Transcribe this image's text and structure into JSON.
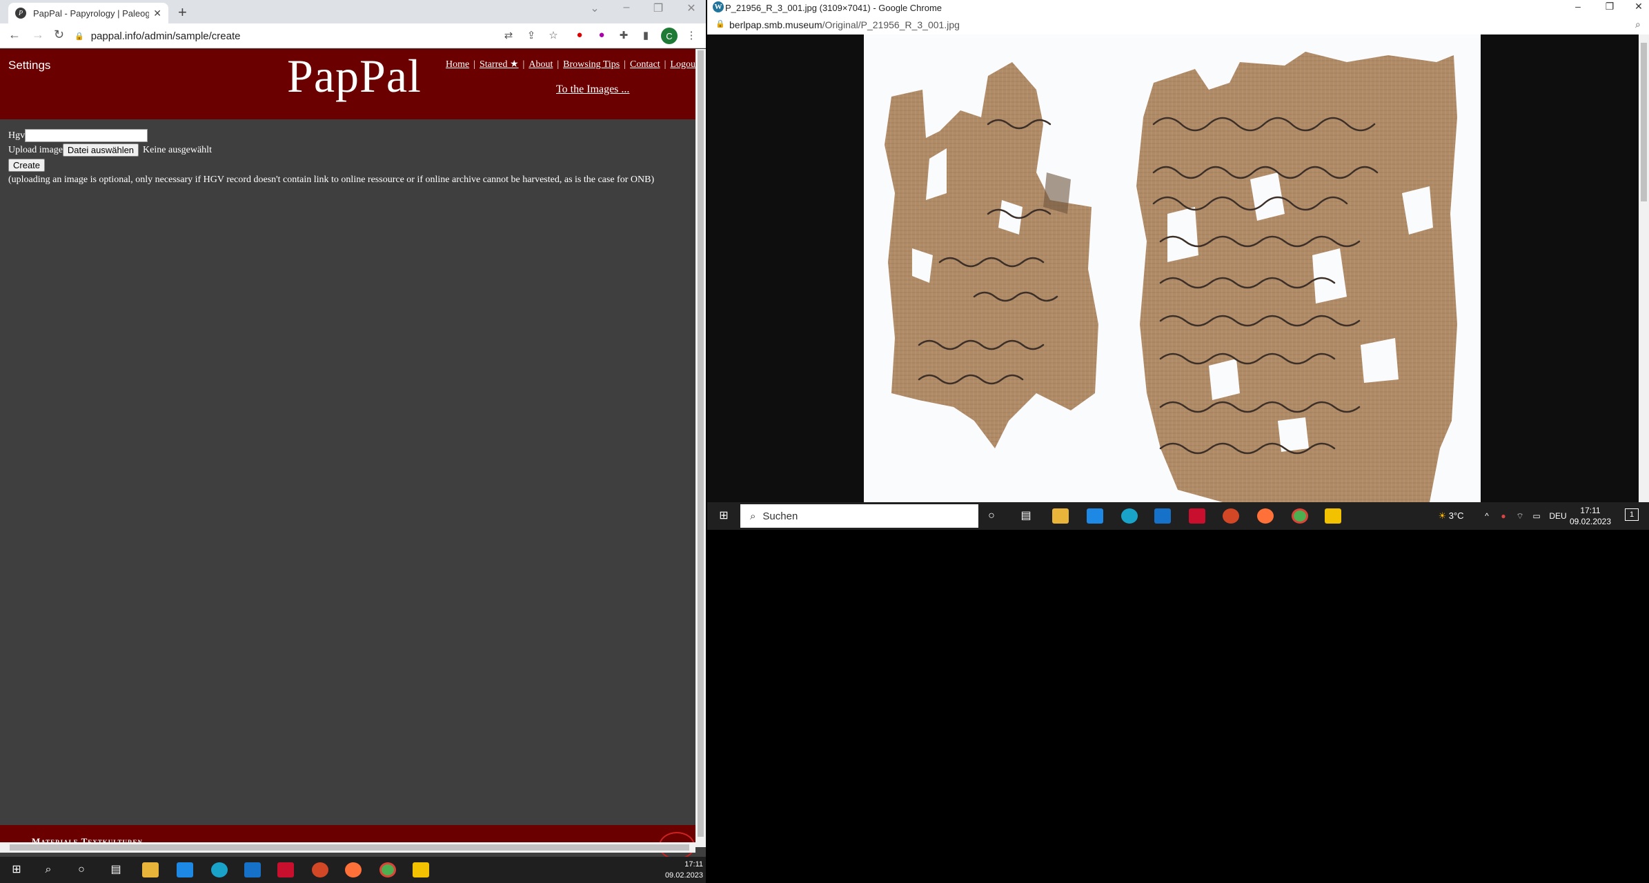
{
  "left_window": {
    "tab_title": "PapPal - Papyrology | Paleograph",
    "url": "pappal.info/admin/sample/create",
    "avatar_letter": "C",
    "page": {
      "settings": "Settings",
      "logo": "PapPal",
      "menu": [
        "Home",
        "Starred ★",
        "About",
        "Browsing Tips",
        "Contact",
        "Logout"
      ],
      "to_images": "To the Images ...",
      "hgv_label": "Hgv",
      "upload_label": "Upload image",
      "file_button": "Datei auswählen",
      "file_status": "Keine ausgewählt",
      "create_button": "Create",
      "note": "(uploading an image is optional, only necessary if HGV record doesn't contain link to online ressource or if online archive cannot be harvested, as is the case for ONB)",
      "footer_text": "Materiale Textkulturen"
    },
    "taskbar_time": "17:11",
    "taskbar_date": "09.02.2023"
  },
  "right_window": {
    "title": "P_21956_R_3_001.jpg (3109×7041) - Google Chrome",
    "url_host": "berlpap.smb.museum",
    "url_path": "/Original/P_21956_R_3_001.jpg",
    "taskbar": {
      "search_placeholder": "Suchen",
      "weather": "3°C",
      "language": "DEU",
      "time": "17:11",
      "date": "09.02.2023",
      "notification_count": "1"
    }
  },
  "colors": {
    "header_red": "#6b0000",
    "page_bg": "#3f3f3f"
  }
}
